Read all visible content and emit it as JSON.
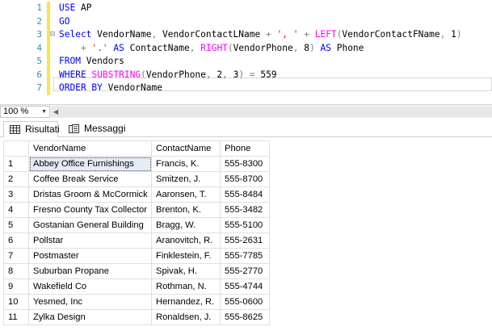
{
  "editor": {
    "lines": [
      {
        "n": "1",
        "parts": [
          {
            "t": "USE",
            "c": "kw"
          },
          {
            "t": " AP",
            "c": ""
          }
        ]
      },
      {
        "n": "2",
        "parts": [
          {
            "t": "GO",
            "c": "kw"
          }
        ]
      },
      {
        "n": "3",
        "parts": [
          {
            "t": "Select",
            "c": "kw"
          },
          {
            "t": " VendorName",
            "c": ""
          },
          {
            "t": ",",
            "c": "op"
          },
          {
            "t": " VendorContactLName ",
            "c": ""
          },
          {
            "t": "+",
            "c": "op"
          },
          {
            "t": " ",
            "c": ""
          },
          {
            "t": "', '",
            "c": "str"
          },
          {
            "t": " ",
            "c": ""
          },
          {
            "t": "+",
            "c": "op"
          },
          {
            "t": " ",
            "c": ""
          },
          {
            "t": "LEFT",
            "c": "fn"
          },
          {
            "t": "(",
            "c": "op"
          },
          {
            "t": "VendorContactFName",
            "c": ""
          },
          {
            "t": ",",
            "c": "op"
          },
          {
            "t": " 1",
            "c": ""
          },
          {
            "t": ")",
            "c": "op"
          }
        ]
      },
      {
        "n": "4",
        "parts": [
          {
            "t": "    ",
            "c": ""
          },
          {
            "t": "+",
            "c": "op"
          },
          {
            "t": " ",
            "c": ""
          },
          {
            "t": "'.'",
            "c": "str"
          },
          {
            "t": " ",
            "c": ""
          },
          {
            "t": "AS",
            "c": "kw"
          },
          {
            "t": " ContactName",
            "c": ""
          },
          {
            "t": ",",
            "c": "op"
          },
          {
            "t": " ",
            "c": ""
          },
          {
            "t": "RIGHT",
            "c": "fn"
          },
          {
            "t": "(",
            "c": "op"
          },
          {
            "t": "VendorPhone",
            "c": ""
          },
          {
            "t": ",",
            "c": "op"
          },
          {
            "t": " 8",
            "c": ""
          },
          {
            "t": ")",
            "c": "op"
          },
          {
            "t": " ",
            "c": ""
          },
          {
            "t": "AS",
            "c": "kw"
          },
          {
            "t": " Phone",
            "c": ""
          }
        ]
      },
      {
        "n": "5",
        "parts": [
          {
            "t": "FROM",
            "c": "kw"
          },
          {
            "t": " Vendors",
            "c": ""
          }
        ]
      },
      {
        "n": "6",
        "parts": [
          {
            "t": "WHERE",
            "c": "kw"
          },
          {
            "t": " ",
            "c": ""
          },
          {
            "t": "SUBSTRING",
            "c": "fn"
          },
          {
            "t": "(",
            "c": "op"
          },
          {
            "t": "VendorPhone",
            "c": ""
          },
          {
            "t": ",",
            "c": "op"
          },
          {
            "t": " 2",
            "c": ""
          },
          {
            "t": ",",
            "c": "op"
          },
          {
            "t": " 3",
            "c": ""
          },
          {
            "t": ")",
            "c": "op"
          },
          {
            "t": " ",
            "c": ""
          },
          {
            "t": "=",
            "c": "op"
          },
          {
            "t": " 559",
            "c": ""
          }
        ]
      },
      {
        "n": "7",
        "parts": [
          {
            "t": "ORDER BY",
            "c": "kw"
          },
          {
            "t": " VendorName",
            "c": ""
          }
        ]
      }
    ]
  },
  "zoom": {
    "value": "100 %"
  },
  "tabs": {
    "results": "Risultati",
    "messages": "Messaggi"
  },
  "grid": {
    "columns": [
      "",
      "VendorName",
      "ContactName",
      "Phone"
    ],
    "rows": [
      [
        "1",
        "Abbey Office Furnishings",
        "Francis, K.",
        "555-8300"
      ],
      [
        "2",
        "Coffee Break Service",
        "Smitzen, J.",
        "555-8700"
      ],
      [
        "3",
        "Dristas Groom & McCormick",
        "Aaronsen, T.",
        "555-8484"
      ],
      [
        "4",
        "Fresno County Tax Collector",
        "Brenton, K.",
        "555-3482"
      ],
      [
        "5",
        "Gostanian General Building",
        "Bragg, W.",
        "555-5100"
      ],
      [
        "6",
        "Pollstar",
        "Aranovitch, R.",
        "555-2631"
      ],
      [
        "7",
        "Postmaster",
        "Finklestein, F.",
        "555-7785"
      ],
      [
        "8",
        "Suburban Propane",
        "Spivak, H.",
        "555-2770"
      ],
      [
        "9",
        "Wakefield Co",
        "Rothman, N.",
        "555-4744"
      ],
      [
        "10",
        "Yesmed, Inc",
        "Hernandez, R.",
        "555-0600"
      ],
      [
        "11",
        "Zylka Design",
        "Ronaldsen, J.",
        "555-8625"
      ]
    ]
  },
  "colors": {
    "keyword": "#0000ff",
    "function": "#ff00ff",
    "string": "#ff0000",
    "operator": "#808080",
    "line_number": "#2b91af",
    "change_bar": "#f8e64a"
  }
}
